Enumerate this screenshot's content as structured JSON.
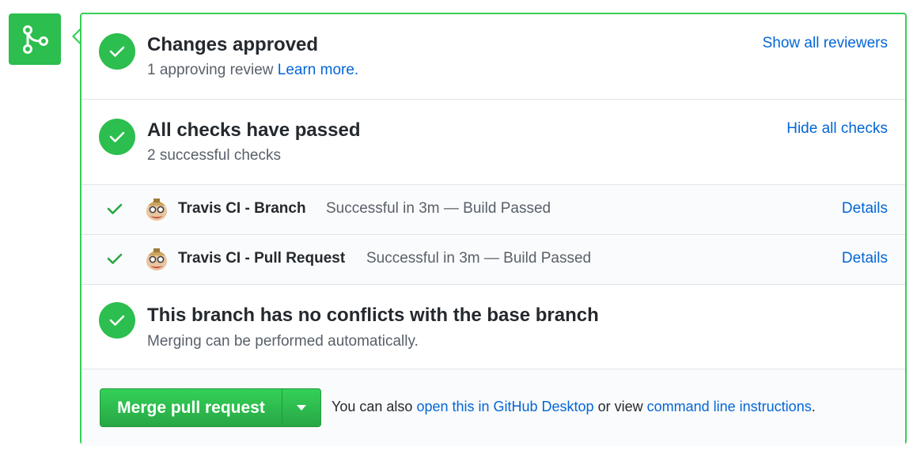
{
  "approvals": {
    "title": "Changes approved",
    "subtitle": "1 approving review",
    "learn_more": "Learn more.",
    "action": "Show all reviewers"
  },
  "checks": {
    "title": "All checks have passed",
    "subtitle": "2 successful checks",
    "action": "Hide all checks",
    "items": [
      {
        "name": "Travis CI - Branch",
        "status": "Successful in 3m — Build Passed",
        "details": "Details"
      },
      {
        "name": "Travis CI - Pull Request",
        "status": "Successful in 3m — Build Passed",
        "details": "Details"
      }
    ]
  },
  "conflicts": {
    "title": "This branch has no conflicts with the base branch",
    "subtitle": "Merging can be performed automatically."
  },
  "merge": {
    "button_label": "Merge pull request",
    "help_prefix": "You can also",
    "desktop_link": "open this in GitHub Desktop",
    "help_middle": "or view",
    "cli_link": "command line instructions",
    "help_suffix": "."
  },
  "colors": {
    "success": "#2cbe4e",
    "border": "#34d058",
    "link": "#0366d6"
  },
  "icons": {
    "badge": "git-merge-icon",
    "status": "check-circle-icon",
    "row_status": "check-icon",
    "avatar": "travis-ci-avatar",
    "dropdown": "caret-down-icon"
  }
}
